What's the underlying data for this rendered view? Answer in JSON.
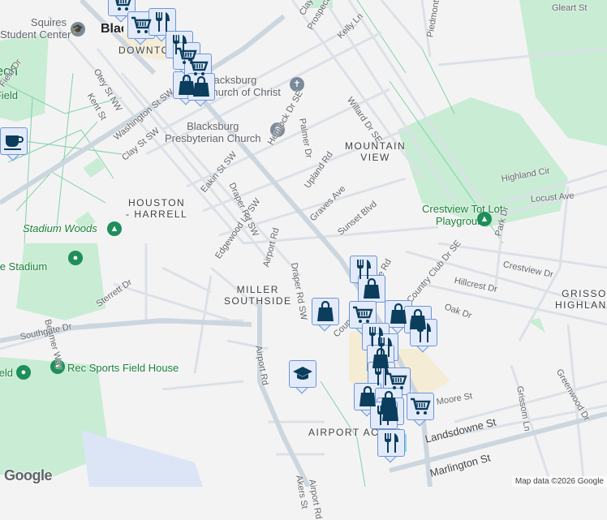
{
  "map": {
    "neighborhoods": [
      "DOWNTOWN",
      "HOUSTON\n- HARRELL",
      "MILLER\nSOUTHSIDE",
      "MOUNTAIN\nVIEW",
      "GRISSOM\nHIGHLANDS",
      "AIRPORT ACRES"
    ],
    "places": {
      "squires": "Squires\nStudent Center",
      "blacksburg": "Blacksburg",
      "church_christ": "Blacksburg\nChurch of Christ",
      "presbyterian": "Blacksburg\nPresbyterian Church",
      "stadium_woods": "Stadium Woods",
      "lane_stadium": "Lane Stadium",
      "crestview": "Crestview Tot Lot\nPlayground",
      "rec_sports": "Rec Sports Field House",
      "tech": "Tech",
      "field": "Field",
      "field2": "Field"
    },
    "streets": [
      "Clay St",
      "Prospect St",
      "Kelly Ln",
      "Piedmont St",
      "Gleart St",
      "Otey St NW",
      "Kent St",
      "Washington St SW",
      "Clay St SW",
      "Palmer Dr",
      "Hemlock Dr SE",
      "Willard Dr SE",
      "Upland Rd",
      "Eakin St SW",
      "Draper Rd SW",
      "Edgewood Ln SW",
      "Graves Ave",
      "Sunset Blvd",
      "Airport Rd",
      "Draper Rd SW",
      "Highland Cir",
      "Locust Ave",
      "Park Dr",
      "Crestview Dr",
      "Hillcrest Dr",
      "Country Club Dr SE",
      "Oak Dr",
      "Country Club Dr",
      "Sterrett Dr",
      "Beamer Way",
      "Southgate Dr",
      "Airport Rd",
      "Greenwood Dr",
      "Grissom Ln",
      "Landsdowne St",
      "Marlington St",
      "Lee Rd",
      "Moore St",
      "Akers St",
      "Field Dr",
      "Airport Rd"
    ],
    "markers": [
      "shopping-cart",
      "shopping-cart",
      "restaurant",
      "restaurant",
      "shopping-bag",
      "shopping-cart",
      "shopping-cart",
      "shopping-bag",
      "coffee",
      "restaurant",
      "shopping-bag",
      "shopping-bag",
      "shopping-cart",
      "shopping-bag",
      "shopping-bag",
      "restaurant",
      "restaurant",
      "restaurant",
      "shopping-bag",
      "restaurant",
      "shopping-cart",
      "shopping-bag",
      "shopping-bag",
      "shopping-bag",
      "shopping-cart",
      "restaurant",
      "restaurant",
      "school"
    ],
    "attribution": "Map data ©2026 Google",
    "logo": "Google",
    "colors": {
      "marker_bg": "#e3ebfb",
      "marker_border": "#6b95d6",
      "marker_icon": "#0b3d5c",
      "park": "#c9ecd4",
      "road": "#d3dbe3",
      "trail": "#7fd3a6"
    }
  }
}
